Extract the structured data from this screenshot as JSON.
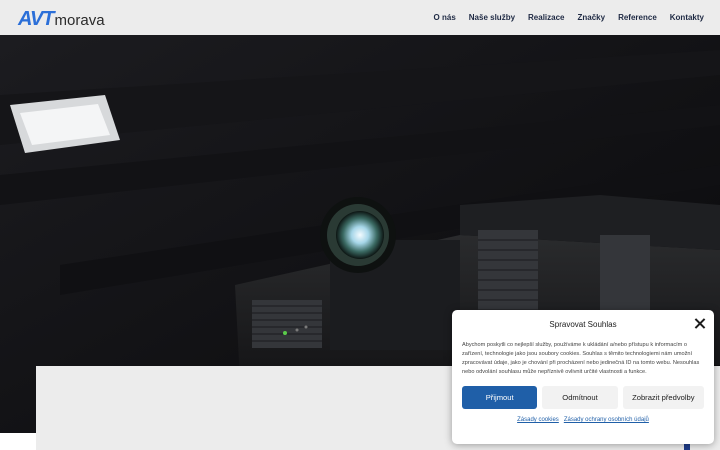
{
  "header": {
    "logo_mark": "AVT",
    "logo_text": "morava",
    "nav": [
      "O nás",
      "Naše služby",
      "Realizace",
      "Značky",
      "Reference",
      "Kontakty"
    ]
  },
  "cookie": {
    "title": "Spravovat Souhlas",
    "text": "Abychom poskytli co nejlepší služby, používáme k ukládání a/nebo přístupu k informacím o zařízení, technologie jako jsou soubory cookies. Souhlas s těmito technologiemi nám umožní zpracovávat údaje, jako je chování při procházení nebo jedinečná ID na tomto webu. Nesouhlas nebo odvolání souhlasu může nepříznivě ovlivnit určité vlastnosti a funkce.",
    "accept": "Přijmout",
    "deny": "Odmítnout",
    "prefs": "Zobrazit předvolby",
    "link_cookies": "Zásady cookies",
    "link_privacy": "Zásady ochrany osobních údajů"
  },
  "colors": {
    "brand_blue": "#2b6fd8",
    "accept_button": "#1f5fa8"
  }
}
